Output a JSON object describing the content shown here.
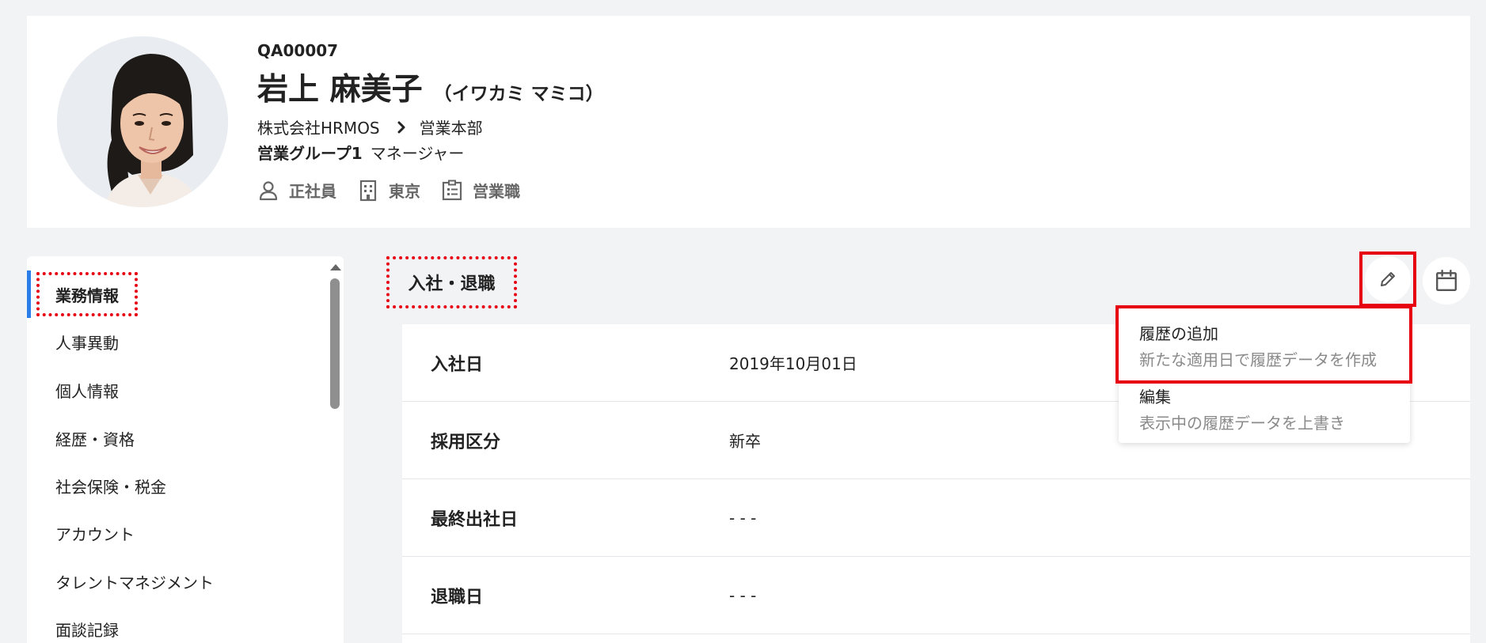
{
  "profile": {
    "employee_id": "QA00007",
    "name": "岩上 麻美子",
    "kana": "（イワカミ マミコ）",
    "company": "株式会社HRMOS",
    "department": "営業本部",
    "group": "営業グループ1",
    "role": "マネージャー",
    "attributes": [
      {
        "icon": "person-icon",
        "label": "正社員"
      },
      {
        "icon": "building-icon",
        "label": "東京"
      },
      {
        "icon": "job-card-icon",
        "label": "営業職"
      }
    ]
  },
  "sidebar": {
    "items": [
      {
        "label": "業務情報"
      },
      {
        "label": "人事異動"
      },
      {
        "label": "個人情報"
      },
      {
        "label": "経歴・資格"
      },
      {
        "label": "社会保険・税金"
      },
      {
        "label": "アカウント"
      },
      {
        "label": "タレントマネジメント"
      },
      {
        "label": "面談記録"
      }
    ],
    "active_index": 0
  },
  "section": {
    "title": "入社・退職"
  },
  "table": {
    "rows": [
      {
        "label": "入社日",
        "value": "2019年10月01日"
      },
      {
        "label": "採用区分",
        "value": "新卒"
      },
      {
        "label": "最終出社日",
        "value": "- - -"
      },
      {
        "label": "退職日",
        "value": "- - -"
      }
    ]
  },
  "dropdown": {
    "items": [
      {
        "title": "履歴の追加",
        "description": "新たな適用日で履歴データを作成"
      },
      {
        "title": "編集",
        "description": "表示中の履歴データを上書き"
      }
    ]
  },
  "colors": {
    "accent": "#2b7de9",
    "highlight": "#e60012",
    "background": "#f2f3f5"
  }
}
